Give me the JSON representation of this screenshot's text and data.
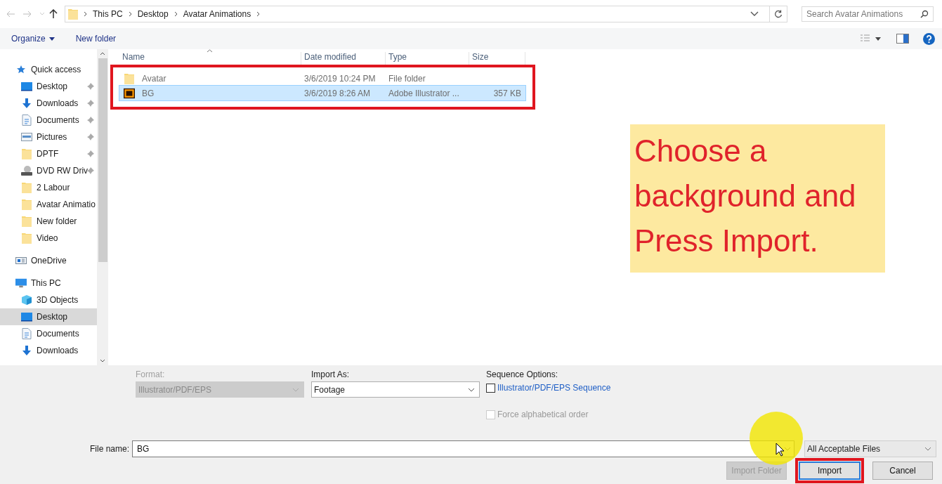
{
  "nav": {
    "breadcrumbs": [
      "This PC",
      "Desktop",
      "Avatar Animations"
    ],
    "search": {
      "placeholder": "Search Avatar Animations"
    }
  },
  "toolbar": {
    "organize": "Organize",
    "new_folder": "New folder"
  },
  "sidebar": {
    "items": [
      {
        "label": "Quick access",
        "kind": "star",
        "pinned": false,
        "selected": false,
        "children": [
          {
            "label": "Desktop",
            "kind": "desktop",
            "pinned": true,
            "selected": false
          },
          {
            "label": "Downloads",
            "kind": "download",
            "pinned": true,
            "selected": false
          },
          {
            "label": "Documents",
            "kind": "document",
            "pinned": true,
            "selected": false
          },
          {
            "label": "Pictures",
            "kind": "pictures",
            "pinned": true,
            "selected": false
          },
          {
            "label": "DPTF",
            "kind": "folder",
            "pinned": true,
            "selected": false
          },
          {
            "label": "DVD RW Driv",
            "kind": "drive",
            "pinned": true,
            "selected": false
          },
          {
            "label": "2 Labour",
            "kind": "folder",
            "pinned": false,
            "selected": false
          },
          {
            "label": "Avatar Animatio",
            "kind": "folder",
            "pinned": false,
            "selected": false
          },
          {
            "label": "New folder",
            "kind": "folder",
            "pinned": false,
            "selected": false
          },
          {
            "label": "Video",
            "kind": "folder",
            "pinned": false,
            "selected": false
          }
        ]
      },
      {
        "label": "OneDrive",
        "kind": "onedrive",
        "pinned": false,
        "selected": false
      },
      {
        "label": "This PC",
        "kind": "pc",
        "pinned": false,
        "selected": false,
        "children": [
          {
            "label": "3D Objects",
            "kind": "objects",
            "pinned": false,
            "selected": false
          },
          {
            "label": "Desktop",
            "kind": "desktop",
            "pinned": false,
            "selected": true
          },
          {
            "label": "Documents",
            "kind": "document",
            "pinned": false,
            "selected": false
          },
          {
            "label": "Downloads",
            "kind": "download",
            "pinned": false,
            "selected": false
          }
        ]
      }
    ]
  },
  "file_list": {
    "columns": [
      "Name",
      "Date modified",
      "Type",
      "Size"
    ],
    "rows": [
      {
        "kind": "folder",
        "name": "Avatar",
        "date_modified": "3/6/2019 10:24 PM",
        "type": "File folder",
        "size": "",
        "selected": false
      },
      {
        "kind": "illustrator",
        "name": "BG",
        "date_modified": "3/6/2019 8:26 AM",
        "type": "Adobe Illustrator ...",
        "size": "357 KB",
        "selected": true
      }
    ]
  },
  "note": "Choose a background and Press Import.",
  "options": {
    "format": {
      "label": "Format:",
      "value": "Illustrator/PDF/EPS",
      "disabled": true
    },
    "import_as": {
      "label": "Import As:",
      "value": "Footage",
      "disabled": false
    },
    "sequence": {
      "label": "Sequence Options:",
      "checkboxes": [
        {
          "label": "Illustrator/PDF/EPS Sequence",
          "checked": false,
          "disabled": false
        },
        {
          "label": "Force alphabetical order",
          "checked": false,
          "disabled": true
        }
      ]
    }
  },
  "file_name": {
    "label": "File name:",
    "value": "BG"
  },
  "file_type": "All Acceptable Files",
  "buttons": [
    {
      "label": "Import Folder",
      "disabled": true,
      "default": false
    },
    {
      "label": "Import",
      "disabled": false,
      "default": true
    },
    {
      "label": "Cancel",
      "disabled": false,
      "default": false
    }
  ]
}
